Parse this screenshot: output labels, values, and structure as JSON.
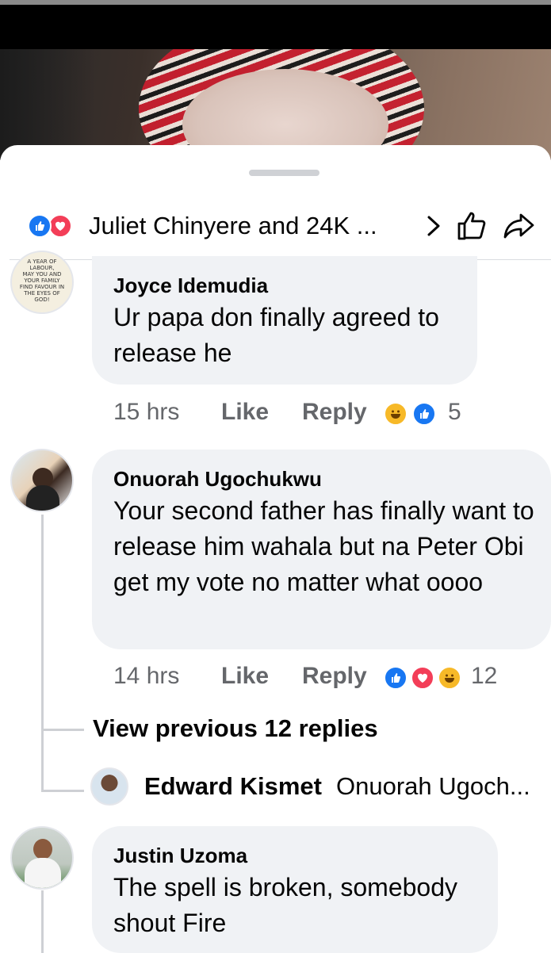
{
  "post_photo": {
    "description_icon": "photo-icon"
  },
  "sheet": {
    "reactions": {
      "summary": "Juliet Chinyere and 24K ...",
      "icons": [
        "like-icon",
        "love-icon"
      ],
      "chevron": "chevron-right-icon",
      "like_button_icon": "thumbs-up-icon",
      "share_button_icon": "share-icon"
    },
    "comments": [
      {
        "name": "Joyce Idemudia",
        "text": "Ur papa don finally agreed to release he",
        "time": "15 hrs",
        "like_label": "Like",
        "reply_label": "Reply",
        "reaction_count": "5",
        "avatar_text": [
          "A YEAR OF",
          "LABOUR,",
          "MAY YOU AND",
          "YOUR FAMILY",
          "FIND FAVOUR IN",
          "THE EYES OF",
          "GOD!"
        ]
      },
      {
        "name": "Onuorah Ugochukwu",
        "text": "Your second father has finally want to release him wahala but na Peter Obi get my vote no matter what oooo",
        "time": "14 hrs",
        "like_label": "Like",
        "reply_label": "Reply",
        "reaction_count": "12"
      },
      {
        "name": "Justin Uzoma",
        "text": "The spell is broken, somebody shout Fire"
      }
    ],
    "replies": {
      "view_previous": "View previous 12 replies",
      "last_reply_name": "Edward Kismet",
      "last_reply_snippet": "Onuorah Ugoch..."
    }
  },
  "colors": {
    "like_blue": "#1877f2",
    "love_red": "#f33e58",
    "haha_yellow": "#f7b928",
    "bubble_gray": "#f0f2f5",
    "meta_gray": "#65676b"
  }
}
